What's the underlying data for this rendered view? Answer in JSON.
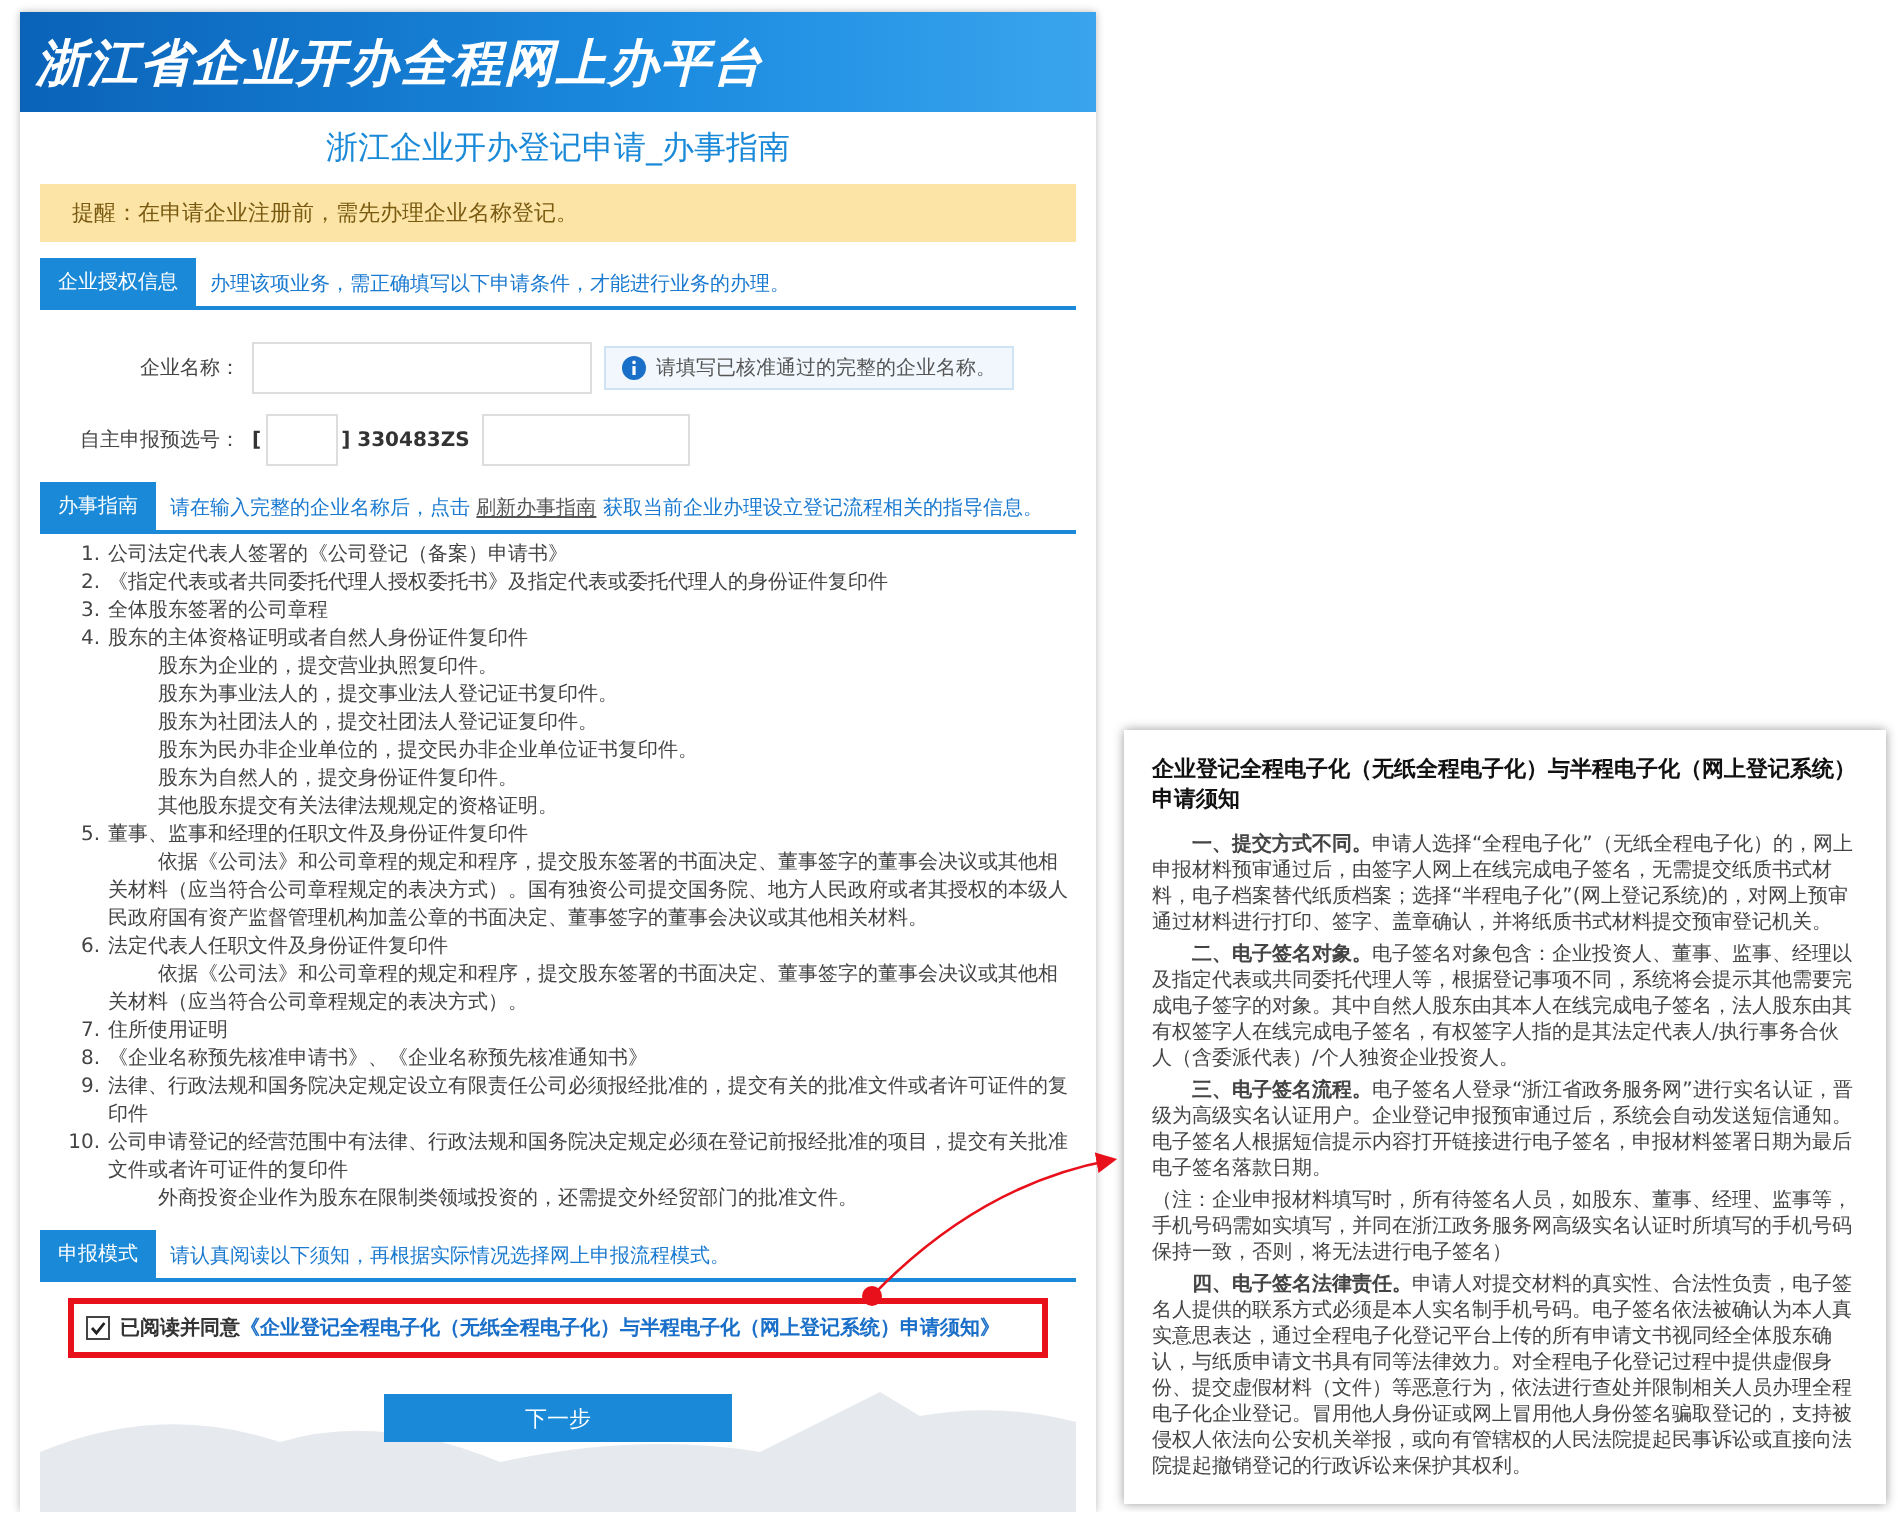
{
  "header": {
    "title": "浙江省企业开办全程网上办平台"
  },
  "page_title": "浙江企业开办登记申请_办事指南",
  "notice": "提醒：在申请企业注册前，需先办理企业名称登记。",
  "auth_section": {
    "tab": "企业授权信息",
    "hint": "办理该项业务，需正确填写以下申请条件，才能进行业务的办理。",
    "fields": [
      {
        "kind": "name",
        "label": "企业名称：",
        "tip": "请填写已核准通过的完整的企业名称。"
      },
      {
        "kind": "code",
        "label": "自主申报预选号：",
        "prefix": "[",
        "middle": "] 330483ZS"
      }
    ]
  },
  "guide_section": {
    "tab": "办事指南",
    "hint_before": "请在输入完整的企业名称后，点击",
    "link": "刷新办事指南",
    "hint_after": "获取当前企业办理设立登记流程相关的指导信息。",
    "items": [
      {
        "number": "1.",
        "text": "公司法定代表人签署的《公司登记（备案）申请书》"
      },
      {
        "number": "2.",
        "text": "《指定代表或者共同委托代理人授权委托书》及指定代表或委托代理人的身份证件复印件"
      },
      {
        "number": "3.",
        "text": "全体股东签署的公司章程"
      },
      {
        "number": "4.",
        "text": "股东的主体资格证明或者自然人身份证件复印件",
        "notes": [
          "股东为企业的，提交营业执照复印件。",
          "股东为事业法人的，提交事业法人登记证书复印件。",
          "股东为社团法人的，提交社团法人登记证复印件。",
          "股东为民办非企业单位的，提交民办非企业单位证书复印件。",
          "股东为自然人的，提交身份证件复印件。",
          "其他股东提交有关法律法规规定的资格证明。"
        ]
      },
      {
        "number": "5.",
        "text": "董事、监事和经理的任职文件及身份证件复印件",
        "notes": [
          "依据《公司法》和公司章程的规定和程序，提交股东签署的书面决定、董事签字的董事会决议或其他相关材料（应当符合公司章程规定的表决方式）。国有独资公司提交国务院、地方人民政府或者其授权的本级人民政府国有资产监督管理机构加盖公章的书面决定、董事签字的董事会决议或其他相关材料。"
        ]
      },
      {
        "number": "6.",
        "text": "法定代表人任职文件及身份证件复印件",
        "notes": [
          "依据《公司法》和公司章程的规定和程序，提交股东签署的书面决定、董事签字的董事会决议或其他相关材料（应当符合公司章程规定的表决方式）。"
        ]
      },
      {
        "number": "7.",
        "text": "住所使用证明"
      },
      {
        "number": "8.",
        "text": "《企业名称预先核准申请书》、《企业名称预先核准通知书》"
      },
      {
        "number": "9.",
        "text": "法律、行政法规和国务院决定规定设立有限责任公司必须报经批准的，提交有关的批准文件或者许可证件的复印件"
      },
      {
        "number": "10.",
        "text": "公司申请登记的经营范围中有法律、行政法规和国务院决定规定必须在登记前报经批准的项目，提交有关批准文件或者许可证件的复印件",
        "notes": [
          "外商投资企业作为股东在限制类领域投资的，还需提交外经贸部门的批准文件。"
        ]
      }
    ]
  },
  "mode_section": {
    "tab": "申报模式",
    "hint": "请认真阅读以下须知，再根据实际情况选择网上申报流程模式。",
    "agreement": {
      "checked": true,
      "label": "已阅读并同意",
      "link": "《企业登记全程电子化（无纸全程电子化）与半程电子化（网上登记系统）申请须知》"
    }
  },
  "next_button": "下一步",
  "notice_doc": {
    "title": "企业登记全程电子化（无纸全程电子化）与半程电子化（网上登记系统）申请须知",
    "paragraphs": [
      {
        "kind": "section",
        "text": "**一、提交方式不同。**申请人选择“全程电子化”（无纸全程电子化）的，网上申报材料预审通过后，由签字人网上在线完成电子签名，无需提交纸质书式材料，电子档案替代纸质档案；选择“半程电子化”(网上登记系统)的，对网上预审通过材料进行打印、签字、盖章确认，并将纸质书式材料提交预审登记机关。"
      },
      {
        "kind": "section",
        "text": "**二、电子签名对象。**电子签名对象包含：企业投资人、董事、监事、经理以及指定代表或共同委托代理人等，根据登记事项不同，系统将会提示其他需要完成电子签字的对象。其中自然人股东由其本人在线完成电子签名，法人股东由其有权签字人在线完成电子签名，有权签字人指的是其法定代表人/执行事务合伙人（含委派代表）/个人独资企业投资人。"
      },
      {
        "kind": "section",
        "text": "**三、电子签名流程。**电子签名人登录“浙江省政务服务网”进行实名认证，晋级为高级实名认证用户。企业登记申报预审通过后，系统会自动发送短信通知。电子签名人根据短信提示内容打开链接进行电子签名，申报材料签署日期为最后电子签名落款日期。"
      },
      {
        "kind": "note",
        "text": "（注：企业申报材料填写时，所有待签名人员，如股东、董事、经理、监事等，手机号码需如实填写，并同在浙江政务服务网高级实名认证时所填写的手机号码保持一致，否则，将无法进行电子签名）"
      },
      {
        "kind": "section",
        "text": "**四、电子签名法律责任。**申请人对提交材料的真实性、合法性负责，电子签名人提供的联系方式必须是本人实名制手机号码。电子签名依法被确认为本人真实意思表达，通过全程电子化登记平台上传的所有申请文书视同经全体股东确认，与纸质申请文书具有同等法律效力。对全程电子化登记过程中提供虚假身份、提交虚假材料（文件）等恶意行为，依法进行查处并限制相关人员办理全程电子化企业登记。冒用他人身份证或网上冒用他人身份签名骗取登记的，支持被侵权人依法向公安机关举报，或向有管辖权的人民法院提起民事诉讼或直接向法院提起撤销登记的行政诉讼来保护其权利。"
      }
    ]
  }
}
